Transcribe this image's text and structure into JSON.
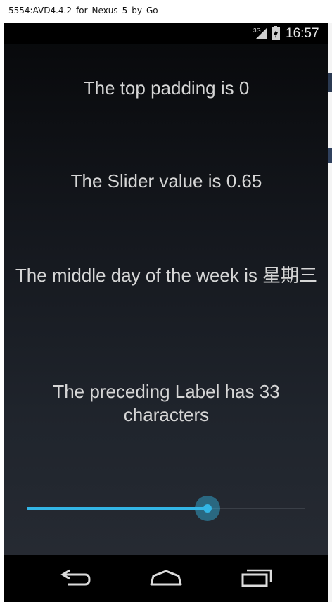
{
  "window": {
    "title": "5554:AVD4.4.2_for_Nexus_5_by_Go"
  },
  "status_bar": {
    "network_label": "3G",
    "time": "16:57",
    "icons": [
      "signal-icon",
      "battery-icon"
    ]
  },
  "labels": {
    "top_padding": "The top padding is 0",
    "slider_value": "The Slider value is 0.65",
    "middle_day": "The middle day of the week is 星期三",
    "preceding_label": "The preceding Label has 33 characters"
  },
  "slider": {
    "value": 0.65,
    "min": 0,
    "max": 1,
    "accent": "#33b5e5"
  },
  "nav_bar": {
    "icons": [
      "back-icon",
      "home-icon",
      "recent-apps-icon"
    ]
  },
  "colors": {
    "accent": "#33b5e5",
    "text": "#d6d6d6",
    "background": "#14171d"
  }
}
